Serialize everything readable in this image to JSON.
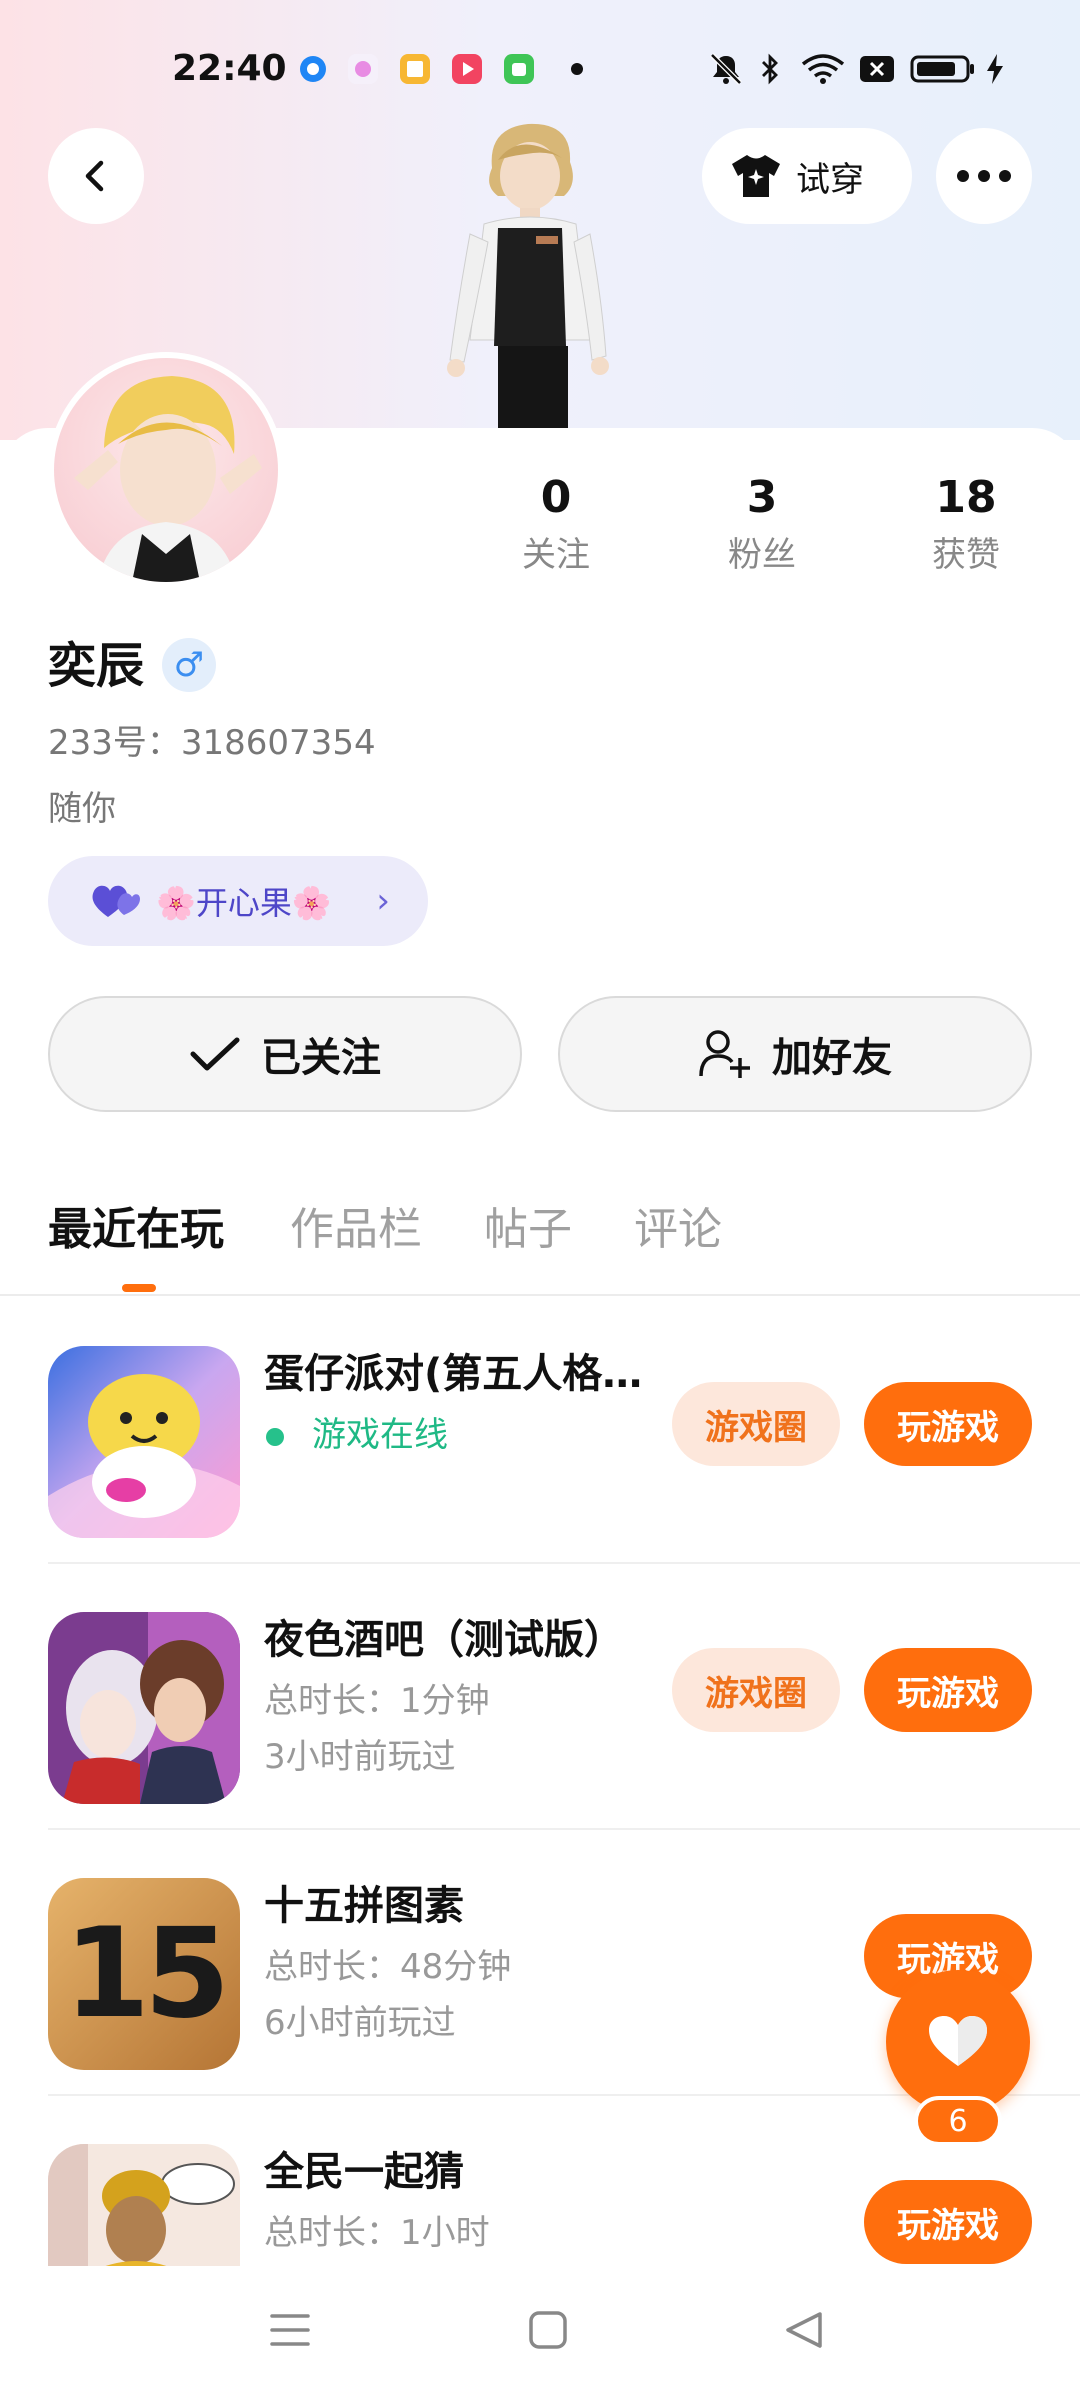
{
  "status_bar": {
    "time": "22:40",
    "colors": {
      "app1": "#1f86f5",
      "app2": "#e88ce3",
      "app3": "#f7b733",
      "app4": "#f24461",
      "app5": "#3fc556"
    }
  },
  "header": {
    "back_icon": "chevron-left-icon",
    "try_on_label": "试穿",
    "more_icon": "more-icon"
  },
  "profile": {
    "stats": [
      {
        "num": "0",
        "label": "关注"
      },
      {
        "num": "3",
        "label": "粉丝"
      },
      {
        "num": "18",
        "label": "获赞"
      }
    ],
    "name": "奕辰",
    "gender_symbol": "♂",
    "uid": "233号：318607354",
    "bio": "随你",
    "pill_text": "🌸开心果🌸",
    "follow_label": "已关注",
    "add_friend_label": "加好友"
  },
  "tabs": [
    {
      "label": "最近在玩",
      "active": true
    },
    {
      "label": "作品栏",
      "active": false
    },
    {
      "label": "帖子",
      "active": false
    },
    {
      "label": "评论",
      "active": false
    }
  ],
  "games": [
    {
      "title": "蛋仔派对(第五人格联动)",
      "line2": "游戏在线",
      "line3": "",
      "circle_label": "游戏圈",
      "play_label": "玩游戏",
      "online": true
    },
    {
      "title": "夜色酒吧（测试版）",
      "line2": "总时长：1分钟",
      "line3": "3小时前玩过",
      "circle_label": "游戏圈",
      "play_label": "玩游戏"
    },
    {
      "title": "十五拼图素",
      "line2": "总时长：48分钟",
      "line3": "6小时前玩过",
      "play_label": "玩游戏"
    },
    {
      "title": "全民一起猜",
      "line2": "总时长：1小时",
      "line3": "",
      "play_label": "玩游戏"
    }
  ],
  "puzzle_icon_text": "15",
  "fab": {
    "count": "6"
  },
  "accent_color": "#ff6e0d"
}
